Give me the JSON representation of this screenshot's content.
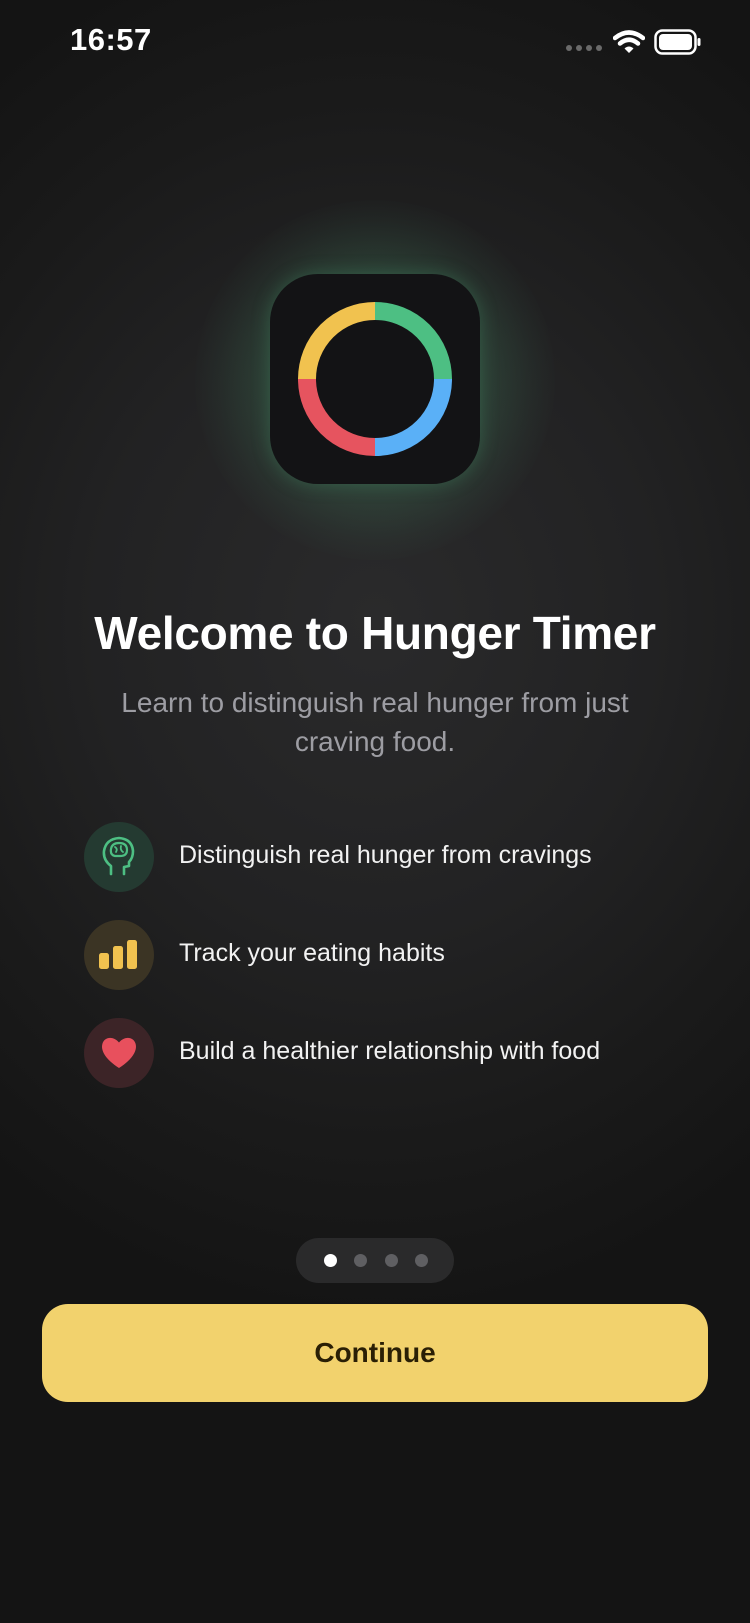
{
  "status_bar": {
    "time": "16:57",
    "icons": [
      "signal-icon",
      "wifi-icon",
      "battery-icon"
    ]
  },
  "app_icon": {
    "name": "hunger-timer-ring-icon",
    "colors": {
      "green": "#4dbf83",
      "blue": "#5ab0f7",
      "red": "#e6545f",
      "yellow": "#f1c24f",
      "background": "#131315",
      "glow": "#4f9f73"
    }
  },
  "onboarding": {
    "title": "Welcome to Hunger Timer",
    "subtitle": "Learn to distinguish real hunger from just craving food.",
    "features": [
      {
        "icon": "brain-head-icon",
        "text": "Distinguish real hunger from cravings",
        "color": "#4dbf83",
        "badge_color": "#243a31"
      },
      {
        "icon": "bar-chart-icon",
        "text": "Track your eating habits",
        "color": "#f1c24f",
        "badge_color": "#3b3424"
      },
      {
        "icon": "heart-icon",
        "text": "Build a healthier relationship with food",
        "color": "#e8505d",
        "badge_color": "#3c2427"
      }
    ]
  },
  "pagination": {
    "current_page": 1,
    "total_pages": 4
  },
  "continue_button": {
    "label": "Continue",
    "color": "#f2d26d"
  }
}
